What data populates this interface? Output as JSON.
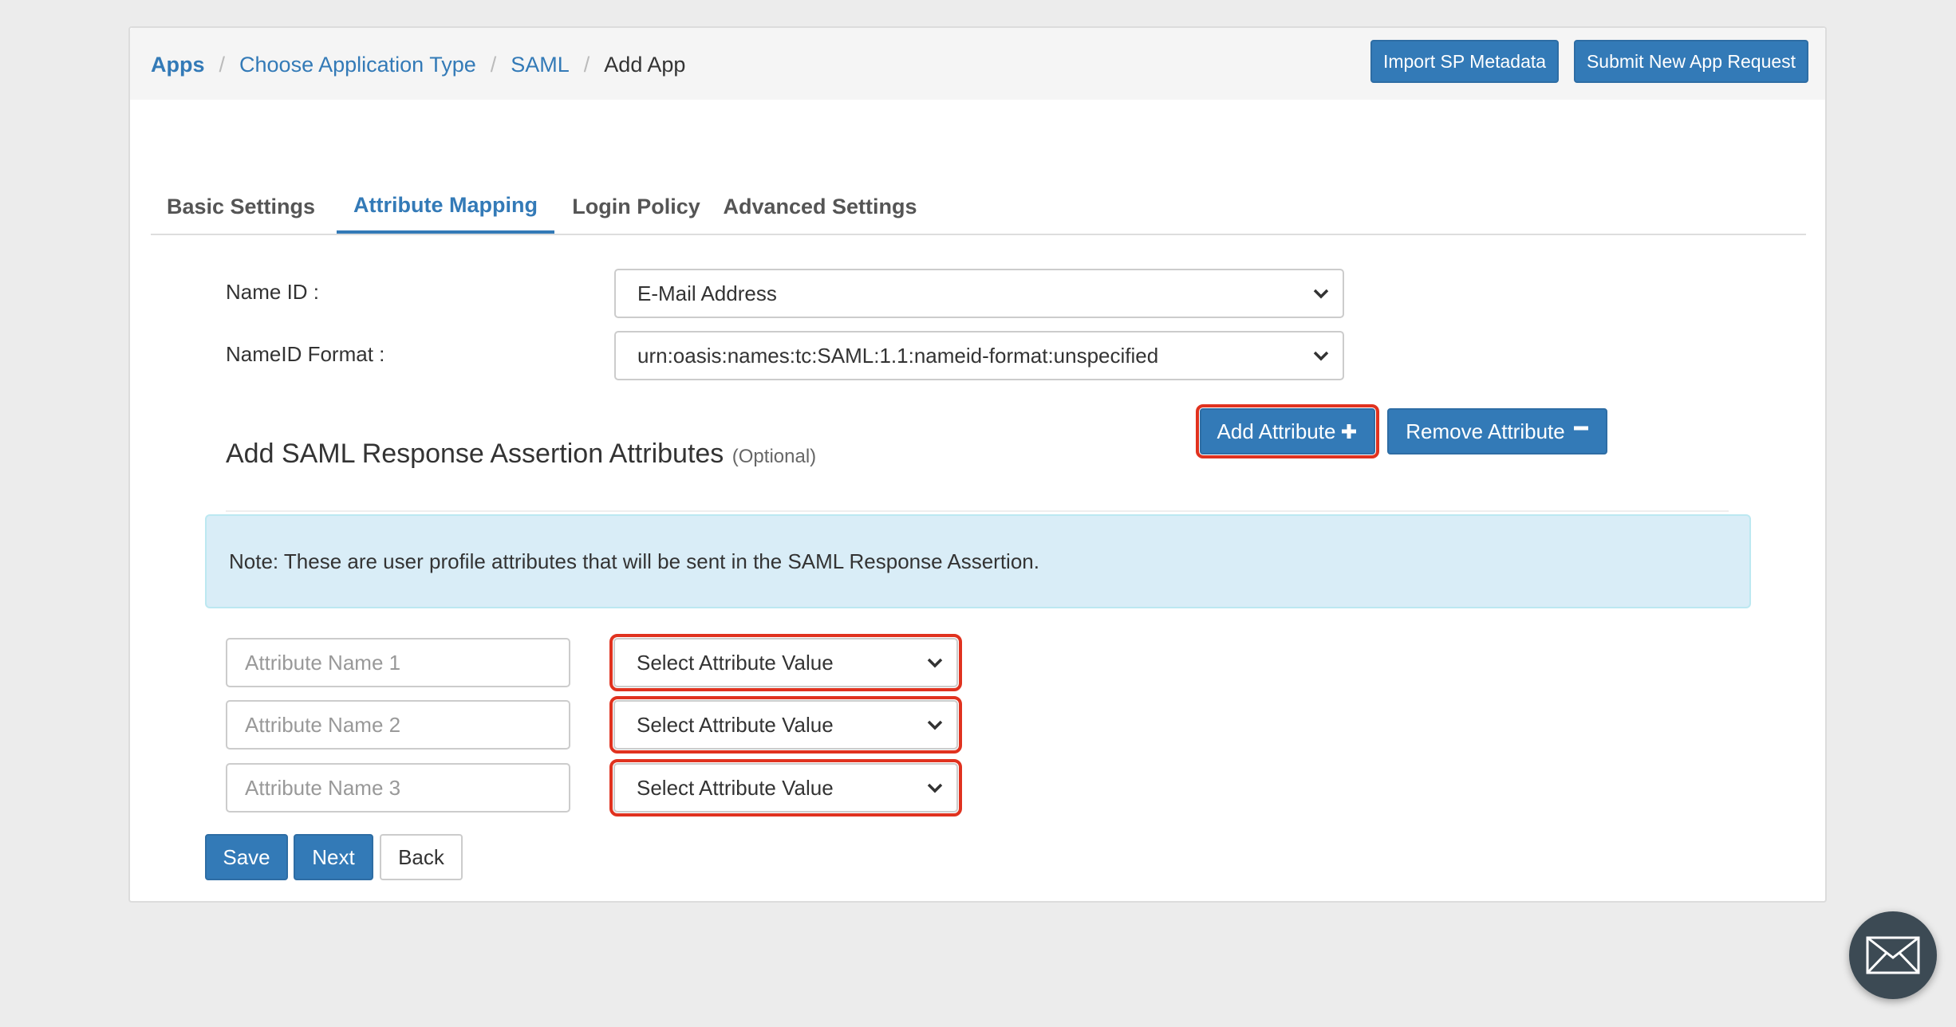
{
  "breadcrumb": {
    "items": [
      "Apps",
      "Choose Application Type",
      "SAML"
    ],
    "current": "Add App",
    "separator": "/"
  },
  "header_buttons": {
    "import": "Import SP Metadata",
    "submit": "Submit New App Request"
  },
  "tabs": [
    {
      "label": "Basic Settings",
      "active": false
    },
    {
      "label": "Attribute Mapping",
      "active": true
    },
    {
      "label": "Login Policy",
      "active": false
    },
    {
      "label": "Advanced Settings",
      "active": false
    }
  ],
  "form": {
    "name_id": {
      "label": "Name ID :",
      "value": "E-Mail Address"
    },
    "name_id_format": {
      "label": "NameID Format :",
      "value": "urn:oasis:names:tc:SAML:1.1:nameid-format:unspecified"
    }
  },
  "assertion": {
    "title": "Add SAML Response Assertion Attributes",
    "optional": "(Optional)",
    "add_button": "Add Attribute",
    "remove_button": "Remove Attribute",
    "note": "Note: These are user profile attributes that will be sent in the SAML Response Assertion."
  },
  "attributes": [
    {
      "name_placeholder": "Attribute Name 1",
      "value": "Select Attribute Value"
    },
    {
      "name_placeholder": "Attribute Name 2",
      "value": "Select Attribute Value"
    },
    {
      "name_placeholder": "Attribute Name 3",
      "value": "Select Attribute Value"
    }
  ],
  "actions": {
    "save": "Save",
    "next": "Next",
    "back": "Back"
  },
  "icons": {
    "add": "plus-icon",
    "remove": "minus-icon",
    "dropdown": "chevron-down-icon",
    "contact": "mail-icon"
  },
  "colors": {
    "primary": "#337ab7",
    "highlight": "#e0321f",
    "note_bg": "#d9edf7"
  }
}
